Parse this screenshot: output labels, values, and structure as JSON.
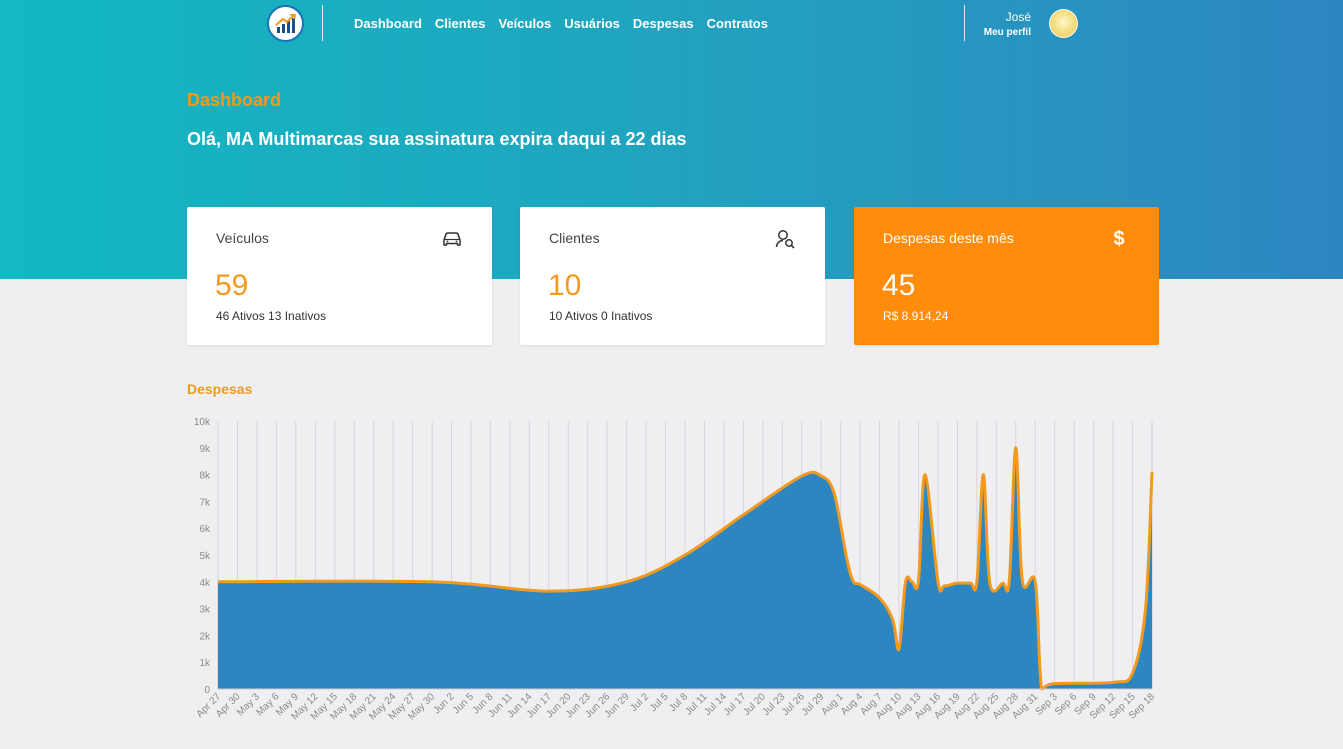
{
  "nav": {
    "links": [
      "Dashboard",
      "Clientes",
      "Veículos",
      "Usuários",
      "Despesas",
      "Contratos"
    ],
    "user_name": "José",
    "profile_link": "Meu perfil"
  },
  "header": {
    "title": "Dashboard",
    "greeting": "Olá, MA Multimarcas sua assinatura expira daqui a 22 dias"
  },
  "cards": [
    {
      "title": "Veículos",
      "value": "59",
      "subtitle": "46 Ativos 13 Inativos",
      "icon": "car-icon"
    },
    {
      "title": "Clientes",
      "value": "10",
      "subtitle": "10 Ativos 0 Inativos",
      "icon": "user-search-icon"
    },
    {
      "title": "Despesas deste mês",
      "value": "45",
      "subtitle": "R$ 8.914,24",
      "icon": "dollar-icon"
    }
  ],
  "colors": {
    "accent": "#f39a1e",
    "orange_card": "#ff8c0a",
    "area_fill": "#2e86c1",
    "line": "#f39a1e"
  },
  "chart_data": {
    "type": "area",
    "title": "Despesas",
    "ylim": [
      0,
      10000
    ],
    "yticks": [
      "0",
      "1k",
      "2k",
      "3k",
      "4k",
      "5k",
      "6k",
      "7k",
      "8k",
      "9k",
      "10k"
    ],
    "xlabels": [
      "Apr 27",
      "Apr 30",
      "May 3",
      "May 6",
      "May 9",
      "May 12",
      "May 15",
      "May 18",
      "May 21",
      "May 24",
      "May 27",
      "May 30",
      "Jun 2",
      "Jun 5",
      "Jun 8",
      "Jun 11",
      "Jun 14",
      "Jun 17",
      "Jun 20",
      "Jun 23",
      "Jun 26",
      "Jun 29",
      "Jul 2",
      "Jul 5",
      "Jul 8",
      "Jul 11",
      "Jul 14",
      "Jul 17",
      "Jul 20",
      "Jul 23",
      "Jul 26",
      "Jul 29",
      "Aug 1",
      "Aug 4",
      "Aug 7",
      "Aug 10",
      "Aug 13",
      "Aug 16",
      "Aug 19",
      "Aug 22",
      "Aug 25",
      "Aug 28",
      "Aug 31",
      "Sep 3",
      "Sep 6",
      "Sep 9",
      "Sep 12",
      "Sep 15",
      "Sep 18"
    ],
    "x_start": "2020-04-27",
    "x_end": "2020-09-18",
    "points": [
      [
        "2020-04-27",
        4000
      ],
      [
        "2020-05-30",
        4000
      ],
      [
        "2020-06-17",
        3650
      ],
      [
        "2020-06-29",
        4000
      ],
      [
        "2020-07-08",
        5000
      ],
      [
        "2020-07-17",
        6500
      ],
      [
        "2020-07-26",
        7950
      ],
      [
        "2020-07-29",
        7950
      ],
      [
        "2020-07-31",
        7300
      ],
      [
        "2020-08-02",
        4800
      ],
      [
        "2020-08-03",
        4000
      ],
      [
        "2020-08-04",
        3900
      ],
      [
        "2020-08-07",
        3400
      ],
      [
        "2020-08-09",
        2600
      ],
      [
        "2020-08-10",
        1500
      ],
      [
        "2020-08-11",
        4000
      ],
      [
        "2020-08-12",
        4000
      ],
      [
        "2020-08-13",
        4050
      ],
      [
        "2020-08-14",
        8000
      ],
      [
        "2020-08-16",
        4000
      ],
      [
        "2020-08-17",
        3850
      ],
      [
        "2020-08-19",
        3950
      ],
      [
        "2020-08-21",
        3950
      ],
      [
        "2020-08-22",
        4000
      ],
      [
        "2020-08-23",
        8000
      ],
      [
        "2020-08-24",
        3950
      ],
      [
        "2020-08-26",
        3950
      ],
      [
        "2020-08-27",
        4050
      ],
      [
        "2020-08-28",
        9000
      ],
      [
        "2020-08-29",
        4050
      ],
      [
        "2020-08-31",
        4000
      ],
      [
        "2020-09-01",
        0
      ],
      [
        "2020-09-03",
        200
      ],
      [
        "2020-09-12",
        250
      ],
      [
        "2020-09-15",
        600
      ],
      [
        "2020-09-17",
        3000
      ],
      [
        "2020-09-18",
        8100
      ]
    ]
  }
}
